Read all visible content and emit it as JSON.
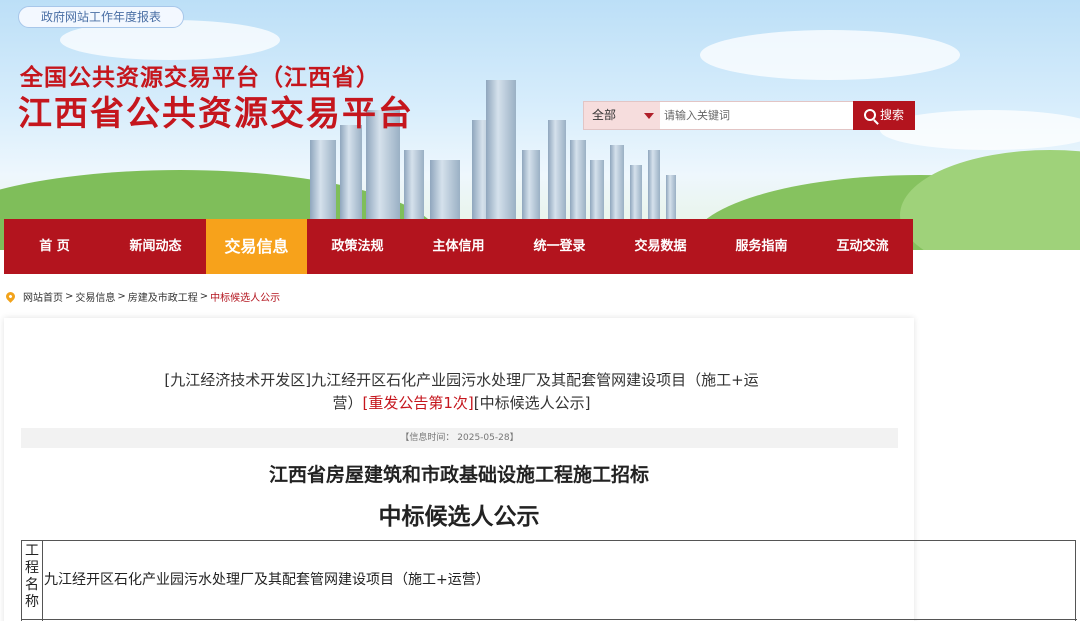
{
  "header": {
    "report_link": "政府网站工作年度报表",
    "title_small": "全国公共资源交易平台（江西省）",
    "title_large": "江西省公共资源交易平台"
  },
  "search": {
    "scope_selected": "全部",
    "placeholder": "请输入关键词",
    "button_label": "搜索"
  },
  "nav": {
    "items": [
      {
        "label": "首 页"
      },
      {
        "label": "新闻动态"
      },
      {
        "label": "交易信息",
        "active": true
      },
      {
        "label": "政策法规"
      },
      {
        "label": "主体信用"
      },
      {
        "label": "统一登录"
      },
      {
        "label": "交易数据"
      },
      {
        "label": "服务指南"
      },
      {
        "label": "互动交流"
      }
    ]
  },
  "breadcrumb": {
    "home": "网站首页",
    "level1": "交易信息",
    "level2": "房建及市政工程",
    "current": "中标候选人公示",
    "sep": ">"
  },
  "article": {
    "title_prefix": "[九江经济技术开发区]九江经开区石化产业园污水处理厂及其配套管网建设项目（施工+运营）",
    "title_highlight": "[重发公告第1次]",
    "title_suffix": "[中标候选人公示]",
    "info_time": "【信息时间：  2025-05-28】",
    "doc_title_1": "江西省房屋建筑和市政基础设施工程施工招标",
    "doc_title_2": "中标候选人公示",
    "table": {
      "head": "工程名称",
      "value": "九江经开区石化产业园污水处理厂及其配套管网建设项目（施工+运营）"
    }
  },
  "colors": {
    "brand_red": "#b3141e",
    "active_orange": "#f7a21b"
  }
}
